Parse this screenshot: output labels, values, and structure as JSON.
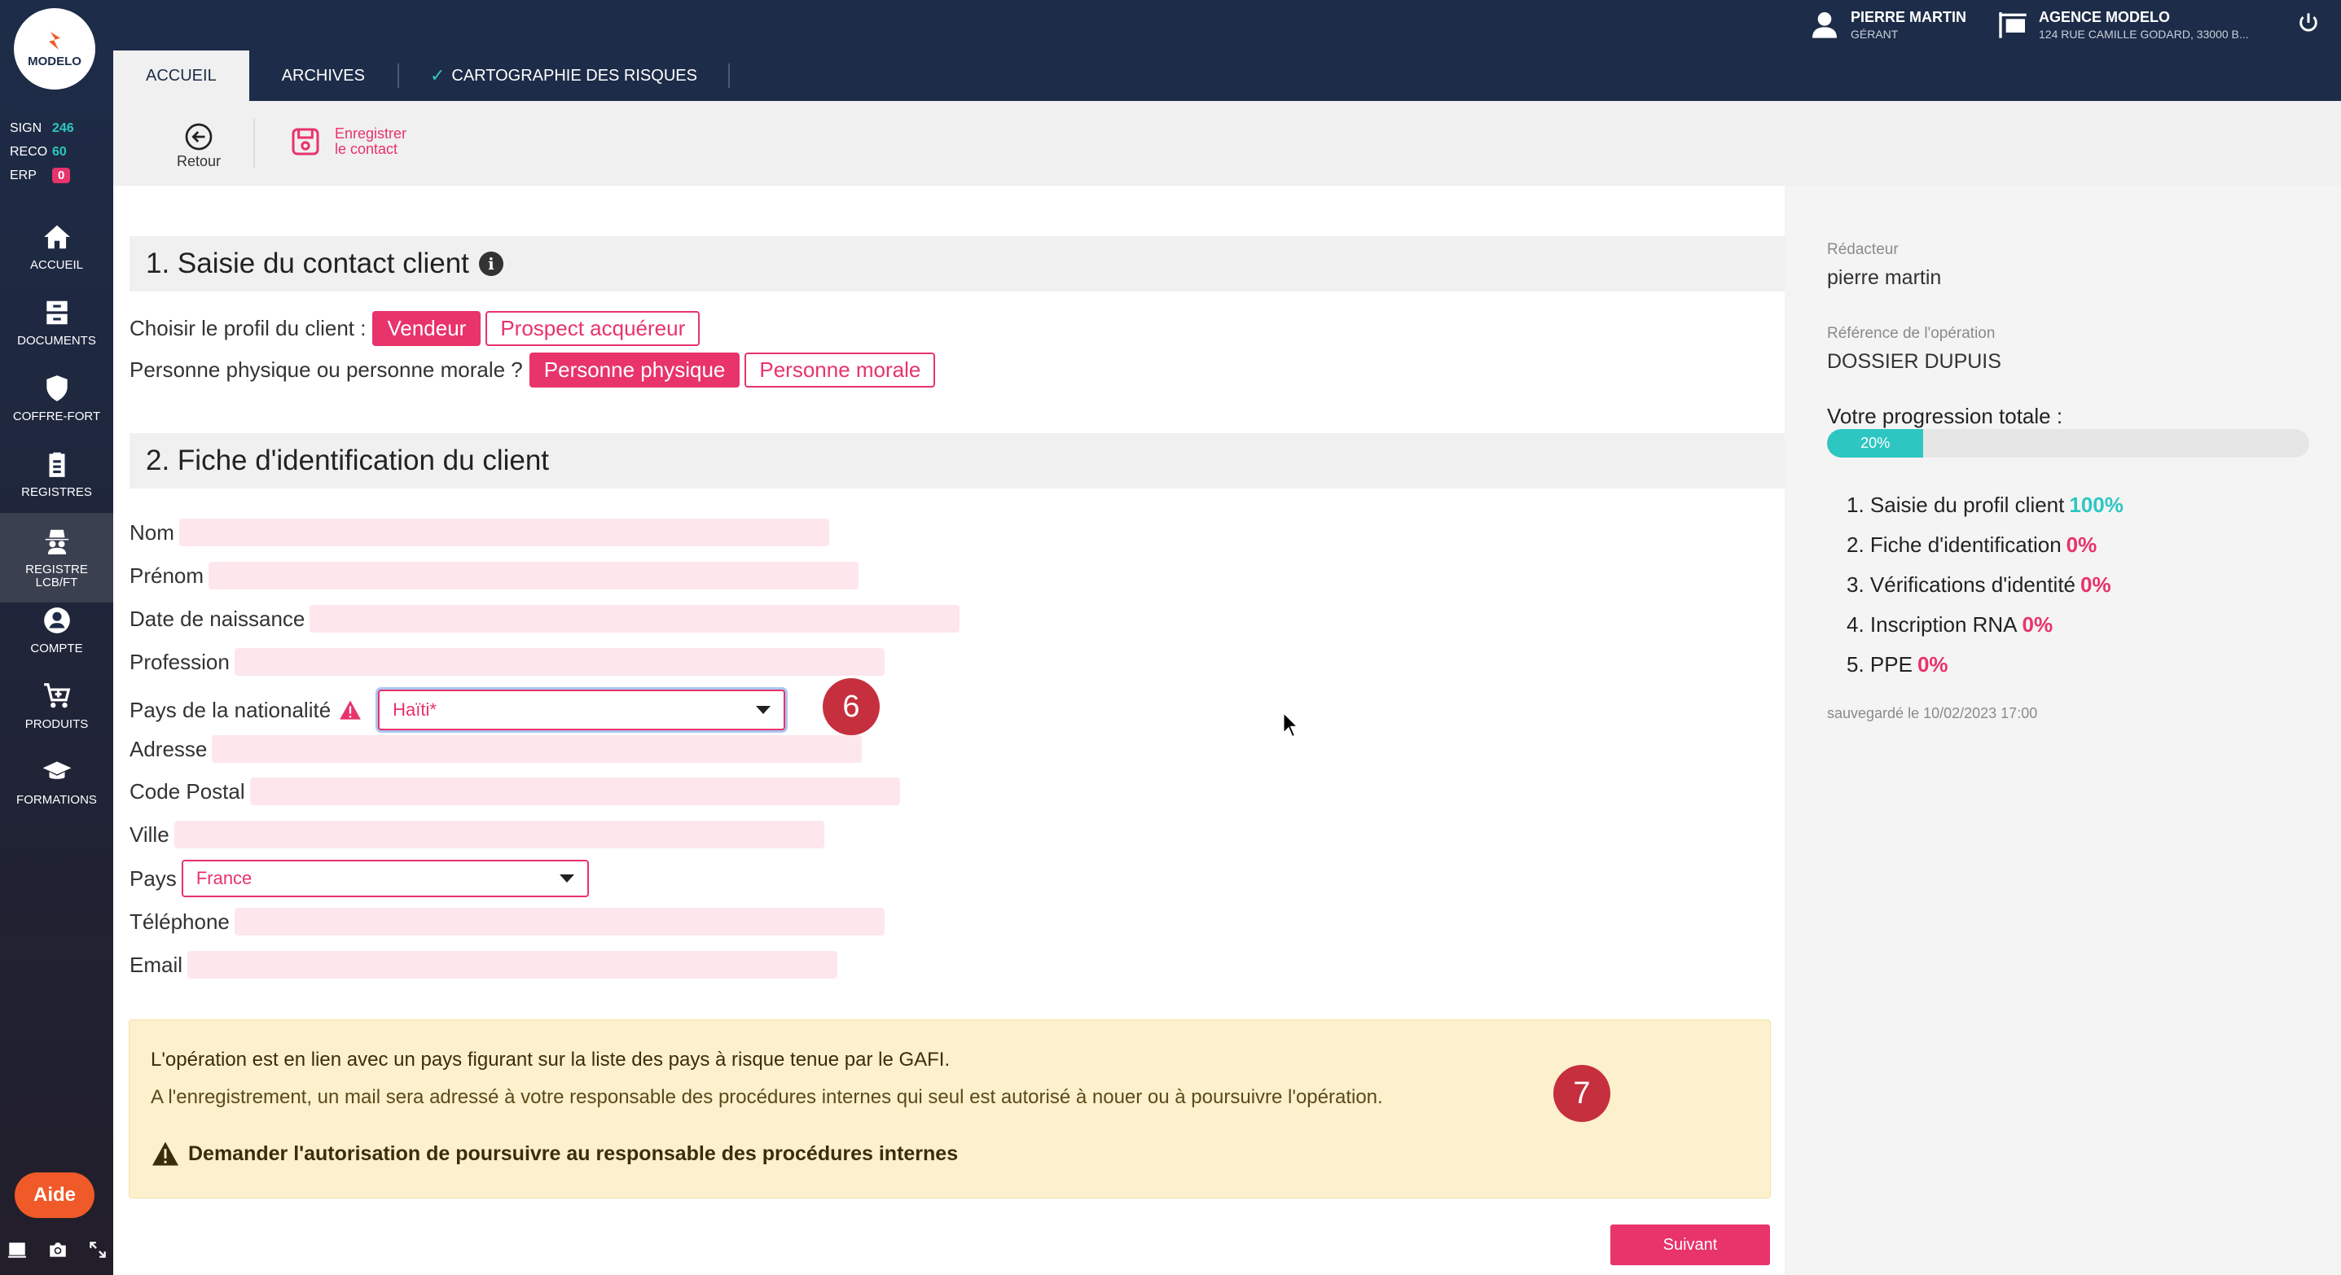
{
  "logo": {
    "text": "MODELO"
  },
  "counters": [
    {
      "label": "SIGN",
      "value": "246"
    },
    {
      "label": "RECO",
      "value": "60"
    },
    {
      "label": "ERP",
      "value": "0"
    }
  ],
  "nav": [
    {
      "label": "ACCUEIL"
    },
    {
      "label": "DOCUMENTS"
    },
    {
      "label": "COFFRE-FORT"
    },
    {
      "label": "REGISTRES"
    },
    {
      "label": "REGISTRE\nLCB/FT"
    },
    {
      "label": "COMPTE"
    },
    {
      "label": "PRODUITS"
    },
    {
      "label": "FORMATIONS"
    }
  ],
  "aide": "Aide",
  "user": {
    "name": "PIERRE MARTIN",
    "role": "GÉRANT"
  },
  "agency": {
    "name": "AGENCE MODELO",
    "address": "124 RUE CAMILLE GODARD, 33000 B..."
  },
  "tabs": [
    {
      "label": "ACCUEIL"
    },
    {
      "label": "ARCHIVES"
    },
    {
      "label": "CARTOGRAPHIE DES RISQUES"
    }
  ],
  "toolbar": {
    "back": "Retour",
    "save_line1": "Enregistrer",
    "save_line2": "le contact"
  },
  "section1": {
    "title": "1. Saisie du contact client",
    "profile_q": "Choisir le profil du client :",
    "profile_opts": [
      "Vendeur",
      "Prospect acquéreur"
    ],
    "person_q": "Personne physique ou personne morale ?",
    "person_opts": [
      "Personne physique",
      "Personne morale"
    ]
  },
  "section2": {
    "title": "2. Fiche d'identification du client",
    "fields": {
      "nom": "Nom",
      "prenom": "Prénom",
      "naissance": "Date de naissance",
      "profession": "Profession",
      "nationalite": "Pays de la nationalité",
      "nationalite_value": "Haïti*",
      "adresse": "Adresse",
      "cp": "Code Postal",
      "ville": "Ville",
      "pays": "Pays",
      "pays_value": "France",
      "telephone": "Téléphone",
      "email": "Email"
    }
  },
  "markers": {
    "m6": "6",
    "m7": "7"
  },
  "alert": {
    "line1": "L'opération est en lien avec un pays figurant sur la liste des pays à risque tenue par le GAFI.",
    "line2": "A l'enregistrement, un mail sera adressé à votre responsable des procédures internes qui seul est autorisé à nouer ou à poursuivre l'opération.",
    "line3": "Demander l'autorisation de poursuivre au responsable des procédures internes"
  },
  "next_button": "Suivant",
  "right_panel": {
    "redacteur_label": "Rédacteur",
    "redacteur": "pierre martin",
    "ref_label": "Référence de l'opération",
    "ref": "DOSSIER DUPUIS",
    "progress_label": "Votre progression totale :",
    "progress_value": 20,
    "progress_text": "20%",
    "steps": [
      {
        "label": "1. Saisie du profil client",
        "pct": "100%",
        "color": "#2ec6c1"
      },
      {
        "label": "2. Fiche d'identification",
        "pct": "0%",
        "color": "#e8336b"
      },
      {
        "label": "3. Vérifications d'identité",
        "pct": "0%",
        "color": "#e8336b"
      },
      {
        "label": "4. Inscription RNA",
        "pct": "0%",
        "color": "#e8336b"
      },
      {
        "label": "5. PPE",
        "pct": "0%",
        "color": "#e8336b"
      }
    ],
    "saved": "sauvegardé le 10/02/2023 17:00"
  },
  "colors": {
    "accent": "#e8336b",
    "teal": "#2ec6c1",
    "navy": "#1d2c48",
    "alert_bg": "#fdf0cc"
  }
}
